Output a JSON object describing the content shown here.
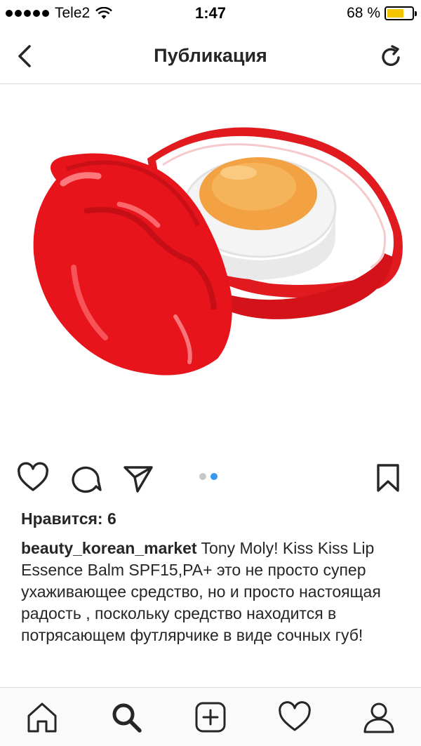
{
  "status_bar": {
    "carrier": "Tele2",
    "time": "1:47",
    "battery": "68 %",
    "battery_level": 0.68
  },
  "nav": {
    "title": "Публикация"
  },
  "post": {
    "image_alt": "Tony Moly Kiss Kiss Lip Essence Balm",
    "carousel_count": 2,
    "carousel_active": 2,
    "likes": "Нравится: 6",
    "username": "beauty_korean_market",
    "caption": " Tony Moly! Kiss Kiss Lip Essence Balm SPF15,PA+ это не просто супер ухаживающее средство, но и просто настоящая радость , поскольку средство находится в потрясающем футлярчике в виде сочных губ!"
  },
  "icons": {
    "back": "chevron-left-icon",
    "refresh": "refresh-icon",
    "like": "heart-icon",
    "comment": "comment-icon",
    "share": "send-icon",
    "save": "bookmark-icon",
    "home": "home-icon",
    "search": "search-icon",
    "add": "add-icon",
    "activity": "heart-icon",
    "profile": "profile-icon"
  },
  "colors": {
    "accent": "#3897f0",
    "battery": "#f5c400",
    "lips": "#e8141c"
  }
}
